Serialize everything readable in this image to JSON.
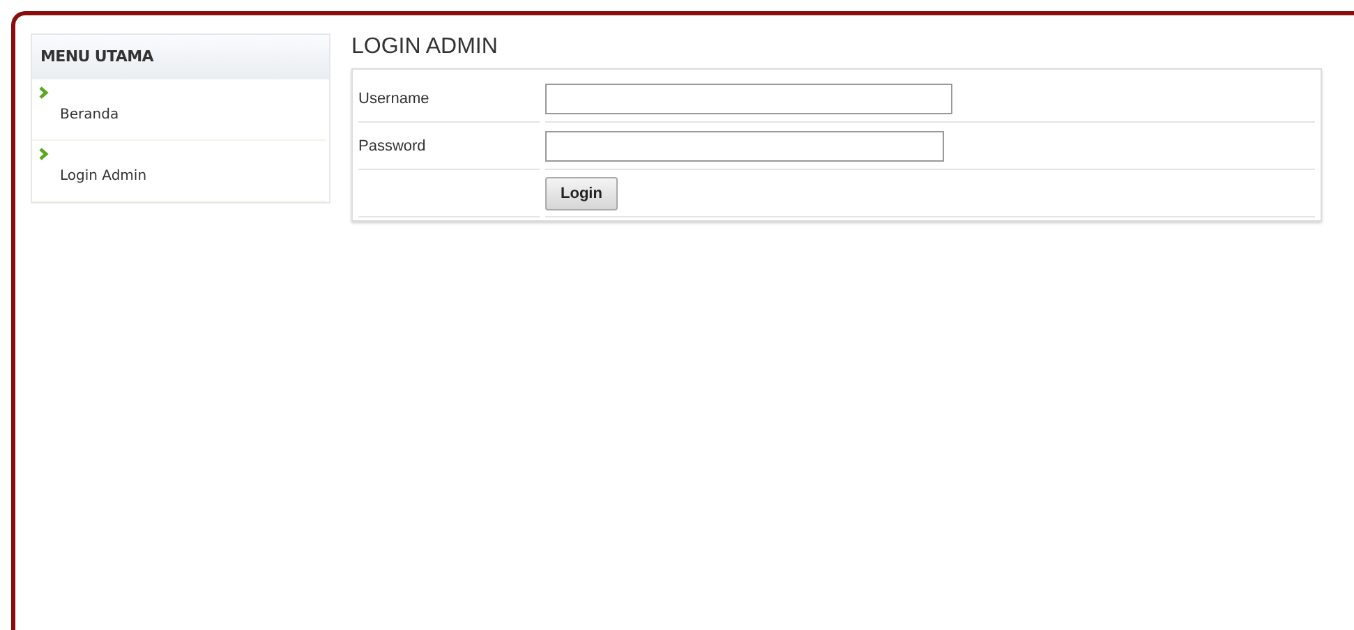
{
  "sidebar": {
    "title": "MENU UTAMA",
    "items": [
      {
        "label": "Beranda"
      },
      {
        "label": "Login Admin"
      }
    ]
  },
  "content": {
    "title": "LOGIN ADMIN",
    "fields": [
      {
        "label": "Username",
        "kind": "text"
      },
      {
        "label": "Password",
        "kind": "password"
      }
    ],
    "button": "Login"
  }
}
